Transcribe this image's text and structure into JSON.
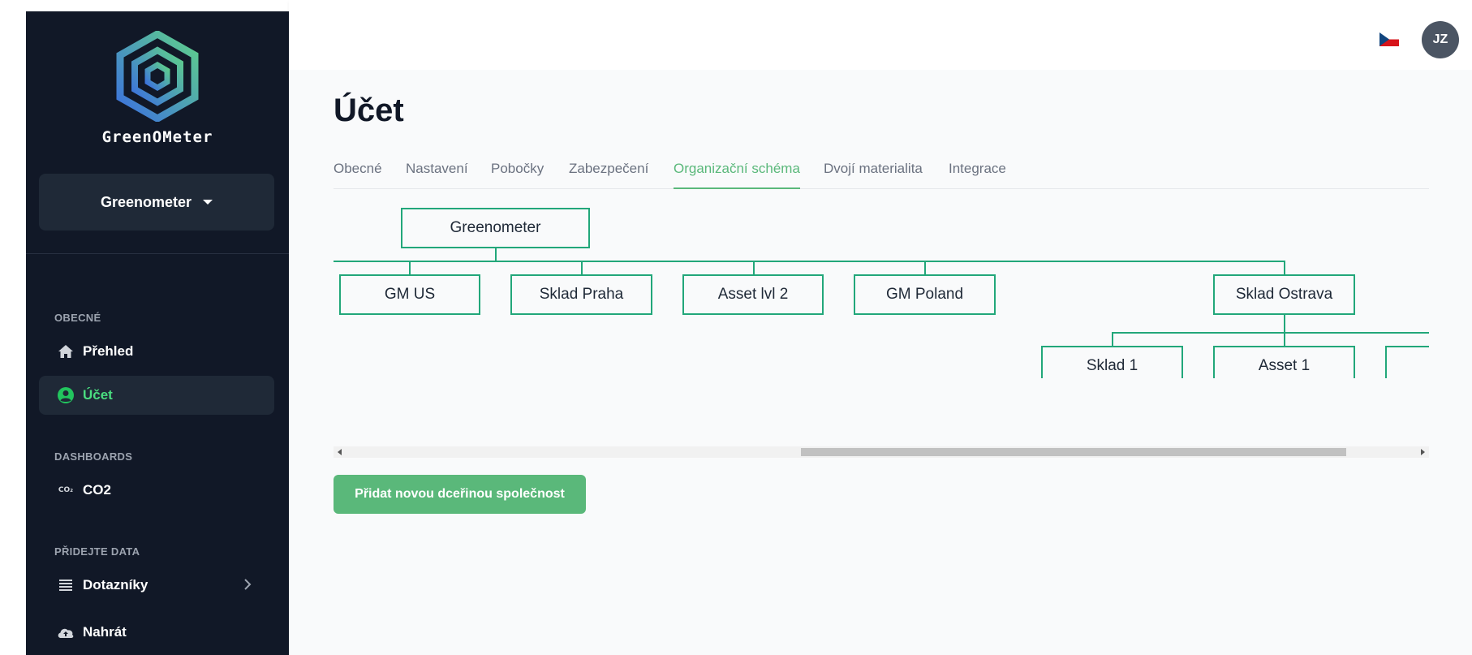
{
  "sidebar": {
    "brand": "GreenOMeter",
    "org_selector": "Greenometer",
    "sections": {
      "general": "OBECNÉ",
      "dashboards": "DASHBOARDS",
      "add_data": "PŘIDEJTE DATA"
    },
    "items": {
      "overview": "Přehled",
      "account": "Účet",
      "co2": "CO2",
      "co2_icon_text": "CO₂",
      "questionnaires": "Dotazníky",
      "upload": "Nahrát"
    }
  },
  "header": {
    "avatar_initials": "JZ",
    "language_icon": "czech-flag-icon"
  },
  "page": {
    "title": "Účet",
    "tabs": [
      {
        "label": "Obecné"
      },
      {
        "label": "Nastavení"
      },
      {
        "label": "Pobočky"
      },
      {
        "label": "Zabezpečení"
      },
      {
        "label": "Organizační schéma",
        "active": true
      },
      {
        "label": "Dvojí materialita"
      },
      {
        "label": "Integrace"
      }
    ],
    "org_chart": {
      "root": "Greenometer",
      "level1": [
        "GM US",
        "Sklad Praha",
        "Asset lvl 2",
        "GM Poland",
        "Sklad Ostrava"
      ],
      "level2": [
        "Sklad 1",
        "Asset 1",
        ""
      ]
    },
    "add_button": "Přidat novou dceřinou společnost"
  },
  "colors": {
    "sidebar_bg": "#111827",
    "accent_green": "#5ab87a",
    "chart_line": "#22a77a",
    "active_nav_text": "#4ade80"
  }
}
